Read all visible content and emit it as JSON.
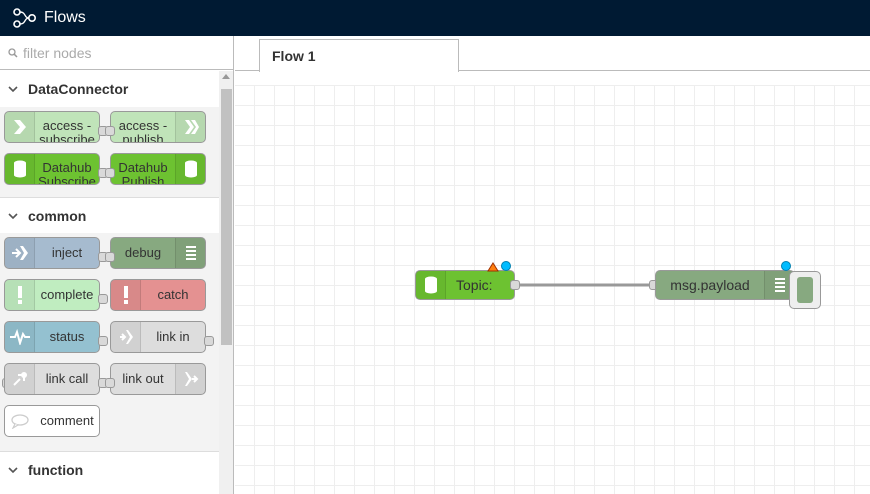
{
  "header": {
    "title": "Flows"
  },
  "palette": {
    "search_placeholder": "filter nodes",
    "categories": [
      {
        "name": "DataConnector",
        "nodes": [
          {
            "label": "access - subscribe",
            "color": "#c0e4b9"
          },
          {
            "label": "access - publish",
            "color": "#c0e4b9"
          },
          {
            "label": "Datahub Subscribe",
            "color": "#6dc231"
          },
          {
            "label": "Datahub Publish",
            "color": "#6dc231"
          }
        ]
      },
      {
        "name": "common",
        "nodes": [
          {
            "label": "inject",
            "color": "#a6bbcf"
          },
          {
            "label": "debug",
            "color": "#87a980"
          },
          {
            "label": "complete",
            "color": "#c0edc0"
          },
          {
            "label": "catch",
            "color": "#e49191"
          },
          {
            "label": "status",
            "color": "#94c1d0"
          },
          {
            "label": "link in",
            "color": "#dddddd"
          },
          {
            "label": "link call",
            "color": "#dddddd"
          },
          {
            "label": "link out",
            "color": "#dddddd"
          },
          {
            "label": "comment",
            "color": "#ffffff"
          }
        ]
      },
      {
        "name": "function"
      }
    ]
  },
  "workspace": {
    "tabs": [
      {
        "label": "Flow 1"
      }
    ],
    "nodes": [
      {
        "label": "Topic:",
        "color": "#6dc231"
      },
      {
        "label": "msg.payload",
        "color": "#87a980"
      }
    ]
  }
}
